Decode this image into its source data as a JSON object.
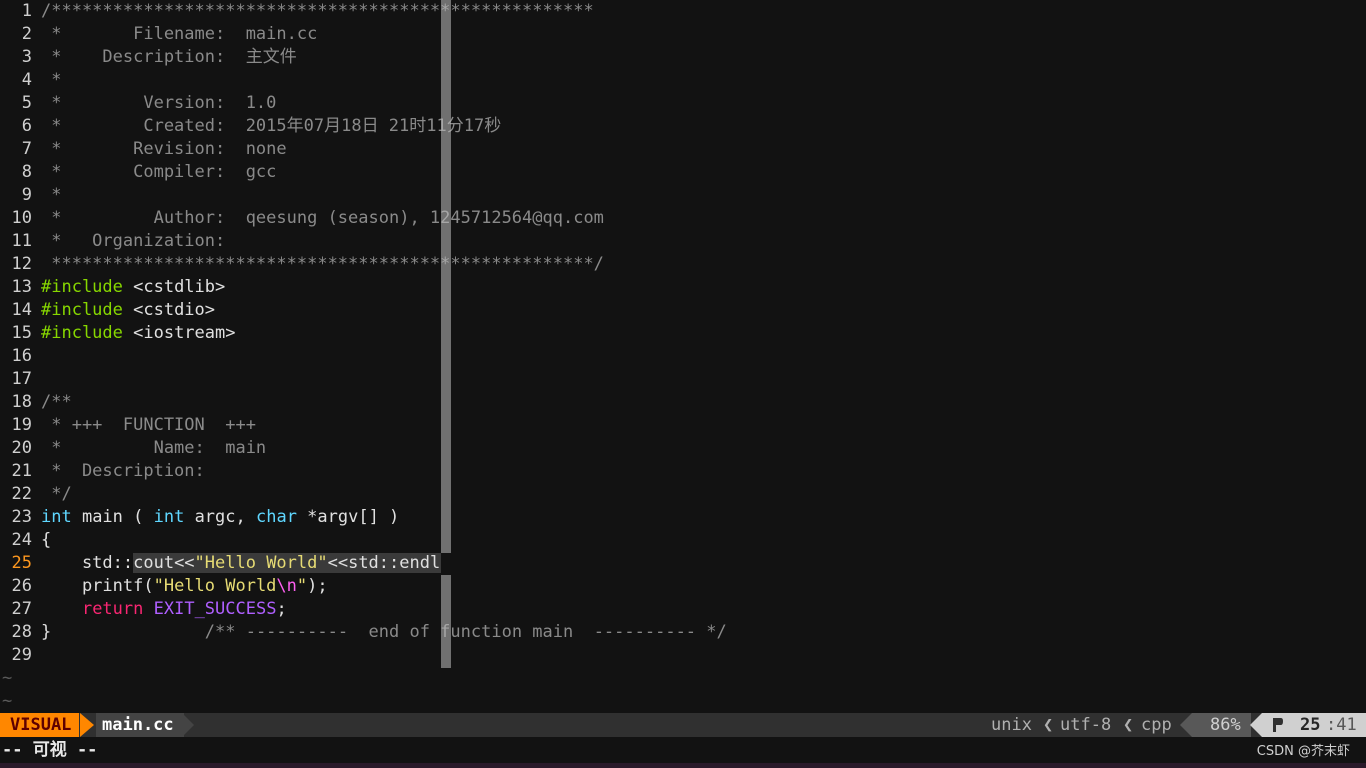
{
  "editor": {
    "lines": [
      {
        "n": "1",
        "segs": [
          [
            "comment",
            "/*****************************************************"
          ]
        ]
      },
      {
        "n": "2",
        "segs": [
          [
            "comment",
            " *       Filename:  main.cc"
          ]
        ]
      },
      {
        "n": "3",
        "segs": [
          [
            "comment",
            " *    Description:  主文件"
          ]
        ]
      },
      {
        "n": "4",
        "segs": [
          [
            "comment",
            " *"
          ]
        ]
      },
      {
        "n": "5",
        "segs": [
          [
            "comment",
            " *        Version:  1.0"
          ]
        ]
      },
      {
        "n": "6",
        "segs": [
          [
            "comment",
            " *        Created:  2015年07月18日 21时11分17秒"
          ]
        ]
      },
      {
        "n": "7",
        "segs": [
          [
            "comment",
            " *       Revision:  none"
          ]
        ]
      },
      {
        "n": "8",
        "segs": [
          [
            "comment",
            " *       Compiler:  gcc"
          ]
        ]
      },
      {
        "n": "9",
        "segs": [
          [
            "comment",
            " *"
          ]
        ]
      },
      {
        "n": "10",
        "segs": [
          [
            "comment",
            " *         Author:  qeesung (season), 1245712564@qq.com"
          ]
        ]
      },
      {
        "n": "11",
        "segs": [
          [
            "comment",
            " *   Organization:"
          ]
        ]
      },
      {
        "n": "12",
        "segs": [
          [
            "comment",
            " *****************************************************/"
          ]
        ]
      },
      {
        "n": "13",
        "segs": [
          [
            "preproc",
            "#include"
          ],
          [
            "plain",
            " <cstdlib>"
          ]
        ]
      },
      {
        "n": "14",
        "segs": [
          [
            "preproc",
            "#include"
          ],
          [
            "plain",
            " <cstdio>"
          ]
        ]
      },
      {
        "n": "15",
        "segs": [
          [
            "preproc",
            "#include"
          ],
          [
            "plain",
            " <iostream>"
          ]
        ]
      },
      {
        "n": "16",
        "segs": []
      },
      {
        "n": "17",
        "segs": []
      },
      {
        "n": "18",
        "segs": [
          [
            "comment",
            "/**"
          ]
        ]
      },
      {
        "n": "19",
        "segs": [
          [
            "comment",
            " * +++  FUNCTION  +++"
          ]
        ]
      },
      {
        "n": "20",
        "segs": [
          [
            "comment",
            " *         Name:  main"
          ]
        ]
      },
      {
        "n": "21",
        "segs": [
          [
            "comment",
            " *  Description:"
          ]
        ]
      },
      {
        "n": "22",
        "segs": [
          [
            "comment",
            " */"
          ]
        ]
      },
      {
        "n": "23",
        "segs": [
          [
            "type",
            "int"
          ],
          [
            "plain",
            " main ( "
          ],
          [
            "type",
            "int"
          ],
          [
            "plain",
            " argc, "
          ],
          [
            "type",
            "char"
          ],
          [
            "plain",
            " *argv[] )"
          ]
        ]
      },
      {
        "n": "24",
        "segs": [
          [
            "plain",
            "{"
          ]
        ]
      },
      {
        "n": "25",
        "cur": true,
        "segs": [
          [
            "plain",
            "    std::"
          ],
          [
            "sel",
            "cout<<"
          ],
          [
            "selstr",
            "\"Hello World\""
          ],
          [
            "sel",
            "<<std::endl;"
          ]
        ]
      },
      {
        "n": "26",
        "segs": [
          [
            "plain",
            "    printf("
          ],
          [
            "str",
            "\"Hello World"
          ],
          [
            "special",
            "\\n"
          ],
          [
            "str",
            "\""
          ],
          [
            "plain",
            ");"
          ]
        ]
      },
      {
        "n": "27",
        "segs": [
          [
            "plain",
            "    "
          ],
          [
            "keyword",
            "return"
          ],
          [
            "plain",
            " "
          ],
          [
            "const",
            "EXIT_SUCCESS"
          ],
          [
            "plain",
            ";"
          ]
        ]
      },
      {
        "n": "28",
        "segs": [
          [
            "plain",
            "}"
          ],
          [
            "comment",
            "               /** ----------  end of function main  ---------- */"
          ]
        ]
      },
      {
        "n": "29",
        "segs": []
      }
    ],
    "tildes": [
      "~",
      "~"
    ]
  },
  "statusline": {
    "mode": "VISUAL",
    "filename": "main.cc",
    "fileformat": "unix",
    "separator": "❮",
    "encoding": "utf-8",
    "filetype": "cpp",
    "percent": "86%",
    "line": "25",
    "col": ":41"
  },
  "cmdline": {
    "text": "-- 可视 --"
  },
  "watermark": {
    "text": "CSDN @芥末虾"
  },
  "colors": {
    "mode_bg": "#ff8700",
    "background": "#121212",
    "current_line_number": "#fd971f"
  },
  "icons": {
    "line_icon": "line-number-icon"
  }
}
